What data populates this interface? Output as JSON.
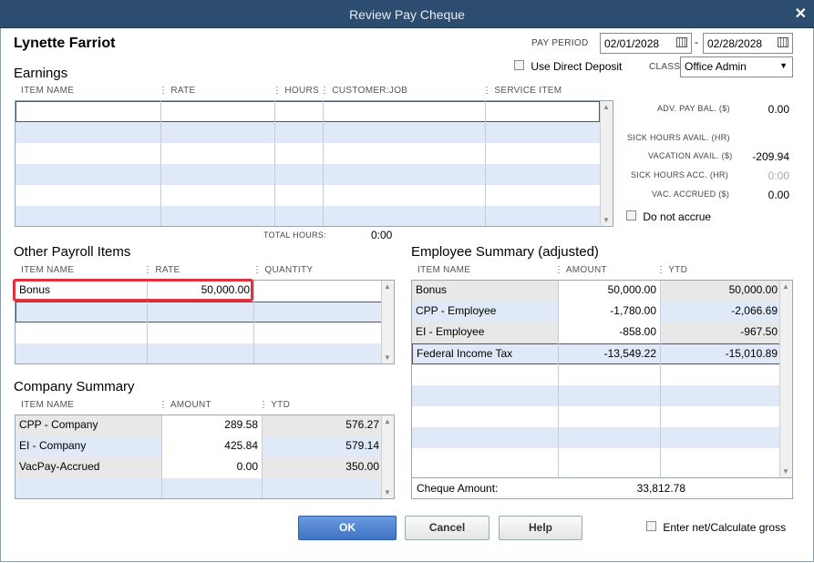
{
  "window": {
    "title": "Review Pay Cheque"
  },
  "employee": {
    "name": "Lynette Farriot"
  },
  "pay_period": {
    "label": "PAY PERIOD",
    "start": "02/01/2028",
    "separator": "-",
    "end": "02/28/2028"
  },
  "direct_deposit": {
    "label": "Use Direct Deposit",
    "checked": false
  },
  "class": {
    "label": "CLASS",
    "value": "Office Admin"
  },
  "earnings": {
    "title": "Earnings",
    "columns": [
      "ITEM NAME",
      "RATE",
      "HOURS",
      "CUSTOMER:JOB",
      "SERVICE ITEM"
    ],
    "total_hours_label": "TOTAL HOURS:",
    "total_hours_value": "0:00"
  },
  "balances": {
    "adv_pay_bal_label": "ADV. PAY BAL. ($)",
    "adv_pay_bal_value": "0.00",
    "sick_hours_avail_label": "SICK HOURS AVAIL. (HR)",
    "vacation_avail_label": "VACATION AVAIL. ($)",
    "vacation_avail_value": "-209.94",
    "sick_hours_acc_label": "SICK HOURS ACC. (HR)",
    "sick_hours_acc_value": "0:00",
    "vac_accrued_label": "VAC. ACCRUED ($)",
    "vac_accrued_value": "0.00",
    "do_not_accrue_label": "Do not accrue"
  },
  "other_payroll": {
    "title": "Other Payroll Items",
    "columns": [
      "ITEM NAME",
      "RATE",
      "QUANTITY"
    ],
    "rows": [
      {
        "item": "Bonus",
        "rate": "50,000.00",
        "quantity": ""
      }
    ]
  },
  "company_summary": {
    "title": "Company Summary",
    "columns": [
      "ITEM NAME",
      "AMOUNT",
      "YTD"
    ],
    "rows": [
      {
        "item": "CPP - Company",
        "amount": "289.58",
        "ytd": "576.27"
      },
      {
        "item": "EI - Company",
        "amount": "425.84",
        "ytd": "579.14"
      },
      {
        "item": "VacPay-Accrued",
        "amount": "0.00",
        "ytd": "350.00"
      }
    ]
  },
  "employee_summary": {
    "title": "Employee Summary (adjusted)",
    "columns": [
      "ITEM NAME",
      "AMOUNT",
      "YTD"
    ],
    "rows": [
      {
        "item": "Bonus",
        "amount": "50,000.00",
        "ytd": "50,000.00"
      },
      {
        "item": "CPP - Employee",
        "amount": "-1,780.00",
        "ytd": "-2,066.69"
      },
      {
        "item": "EI - Employee",
        "amount": "-858.00",
        "ytd": "-967.50"
      },
      {
        "item": "Federal Income Tax",
        "amount": "-13,549.22",
        "ytd": "-15,010.89"
      }
    ],
    "cheque_amount_label": "Cheque Amount:",
    "cheque_amount_value": "33,812.78"
  },
  "buttons": {
    "ok": "OK",
    "cancel": "Cancel",
    "help": "Help"
  },
  "enter_net": {
    "label": "Enter net/Calculate gross",
    "checked": false
  },
  "colors": {
    "titlebar": "#2d4d70",
    "row_alt": "#dfe9f7",
    "highlight": "#e0323a",
    "primary_button": "#3f73c4"
  }
}
